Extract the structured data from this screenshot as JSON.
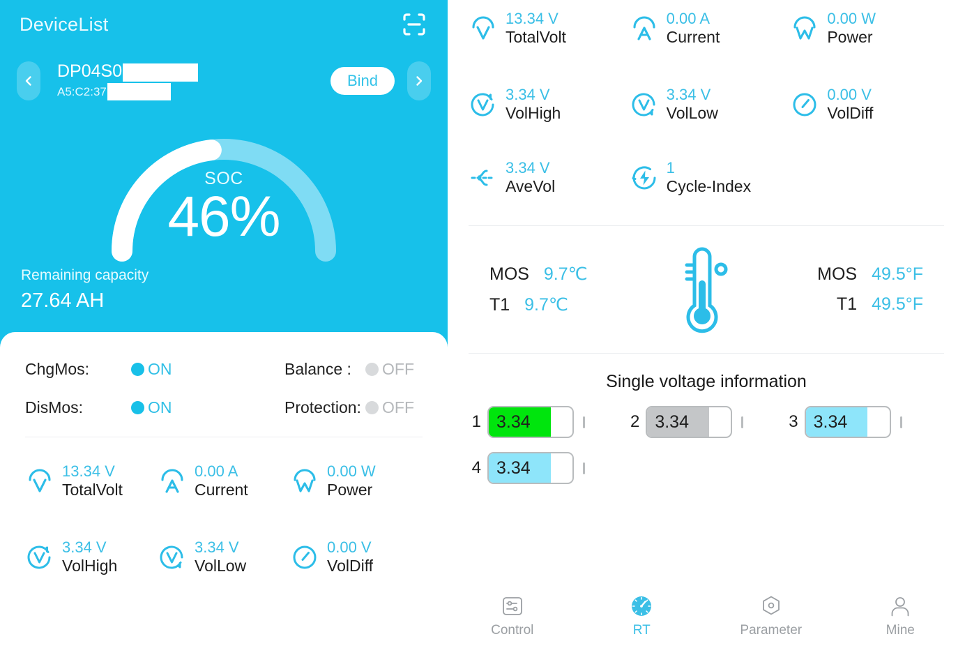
{
  "header": {
    "title": "DeviceList",
    "scan_icon": "scan-qr-icon"
  },
  "device": {
    "prev_icon": "chevron-left-icon",
    "next_icon": "chevron-right-icon",
    "name": "DP04S0",
    "mac": "A5:C2:37",
    "bind_label": "Bind"
  },
  "soc": {
    "label": "SOC",
    "value": "46%",
    "percent": 46,
    "remaining_label": "Remaining capacity",
    "remaining_value": "27.64 AH"
  },
  "status": [
    {
      "key": "ChgMos:",
      "value": "ON",
      "state": "on"
    },
    {
      "key": "Balance :",
      "value": "OFF",
      "state": "off"
    },
    {
      "key": "DisMos:",
      "value": "ON",
      "state": "on"
    },
    {
      "key": "Protection:",
      "value": "OFF",
      "state": "off"
    }
  ],
  "metrics": [
    {
      "value": "13.34 V",
      "name": "TotalVolt",
      "icon": "volt-gauge-icon"
    },
    {
      "value": "0.00 A",
      "name": "Current",
      "icon": "ampere-gauge-icon"
    },
    {
      "value": "0.00 W",
      "name": "Power",
      "icon": "watt-gauge-icon"
    },
    {
      "value": "3.34 V",
      "name": "VolHigh",
      "icon": "volt-high-icon"
    },
    {
      "value": "3.34 V",
      "name": "VolLow",
      "icon": "volt-low-icon"
    },
    {
      "value": "0.00 V",
      "name": "VolDiff",
      "icon": "volt-diff-icon"
    }
  ],
  "metrics_extra": [
    {
      "value": "3.34 V",
      "name": "AveVol",
      "icon": "average-voltage-icon"
    },
    {
      "value": "1",
      "name": "Cycle-Index",
      "icon": "cycle-bolt-icon"
    }
  ],
  "temperature": {
    "celsius": [
      {
        "key": "MOS",
        "value": "9.7℃"
      },
      {
        "key": "T1",
        "value": "9.7℃"
      }
    ],
    "fahrenheit": [
      {
        "key": "MOS",
        "value": "49.5°F"
      },
      {
        "key": "T1",
        "value": "49.5°F"
      }
    ],
    "icon": "thermometer-icon"
  },
  "single_voltage": {
    "title": "Single voltage information",
    "cells": [
      {
        "index": "1",
        "value": "3.34",
        "color": "#00e50d",
        "fill_pct": 74
      },
      {
        "index": "2",
        "value": "3.34",
        "color": "#c4c6c8",
        "fill_pct": 74
      },
      {
        "index": "3",
        "value": "3.34",
        "color": "#8ee5fa",
        "fill_pct": 74
      },
      {
        "index": "4",
        "value": "3.34",
        "color": "#8ee5fa",
        "fill_pct": 74
      }
    ]
  },
  "tabs": [
    {
      "label": "Control",
      "icon": "sliders-icon",
      "active": false
    },
    {
      "label": "RT",
      "icon": "speedometer-icon",
      "active": true
    },
    {
      "label": "Parameter",
      "icon": "hexagon-gear-icon",
      "active": false
    },
    {
      "label": "Mine",
      "icon": "person-icon",
      "active": false
    }
  ],
  "colors": {
    "brand": "#17c1ea",
    "accent_text": "#3bbfe6",
    "gauge_track": "#7fdcf4",
    "gauge_fill": "#ffffff",
    "inactive": "#9b9fa3"
  }
}
